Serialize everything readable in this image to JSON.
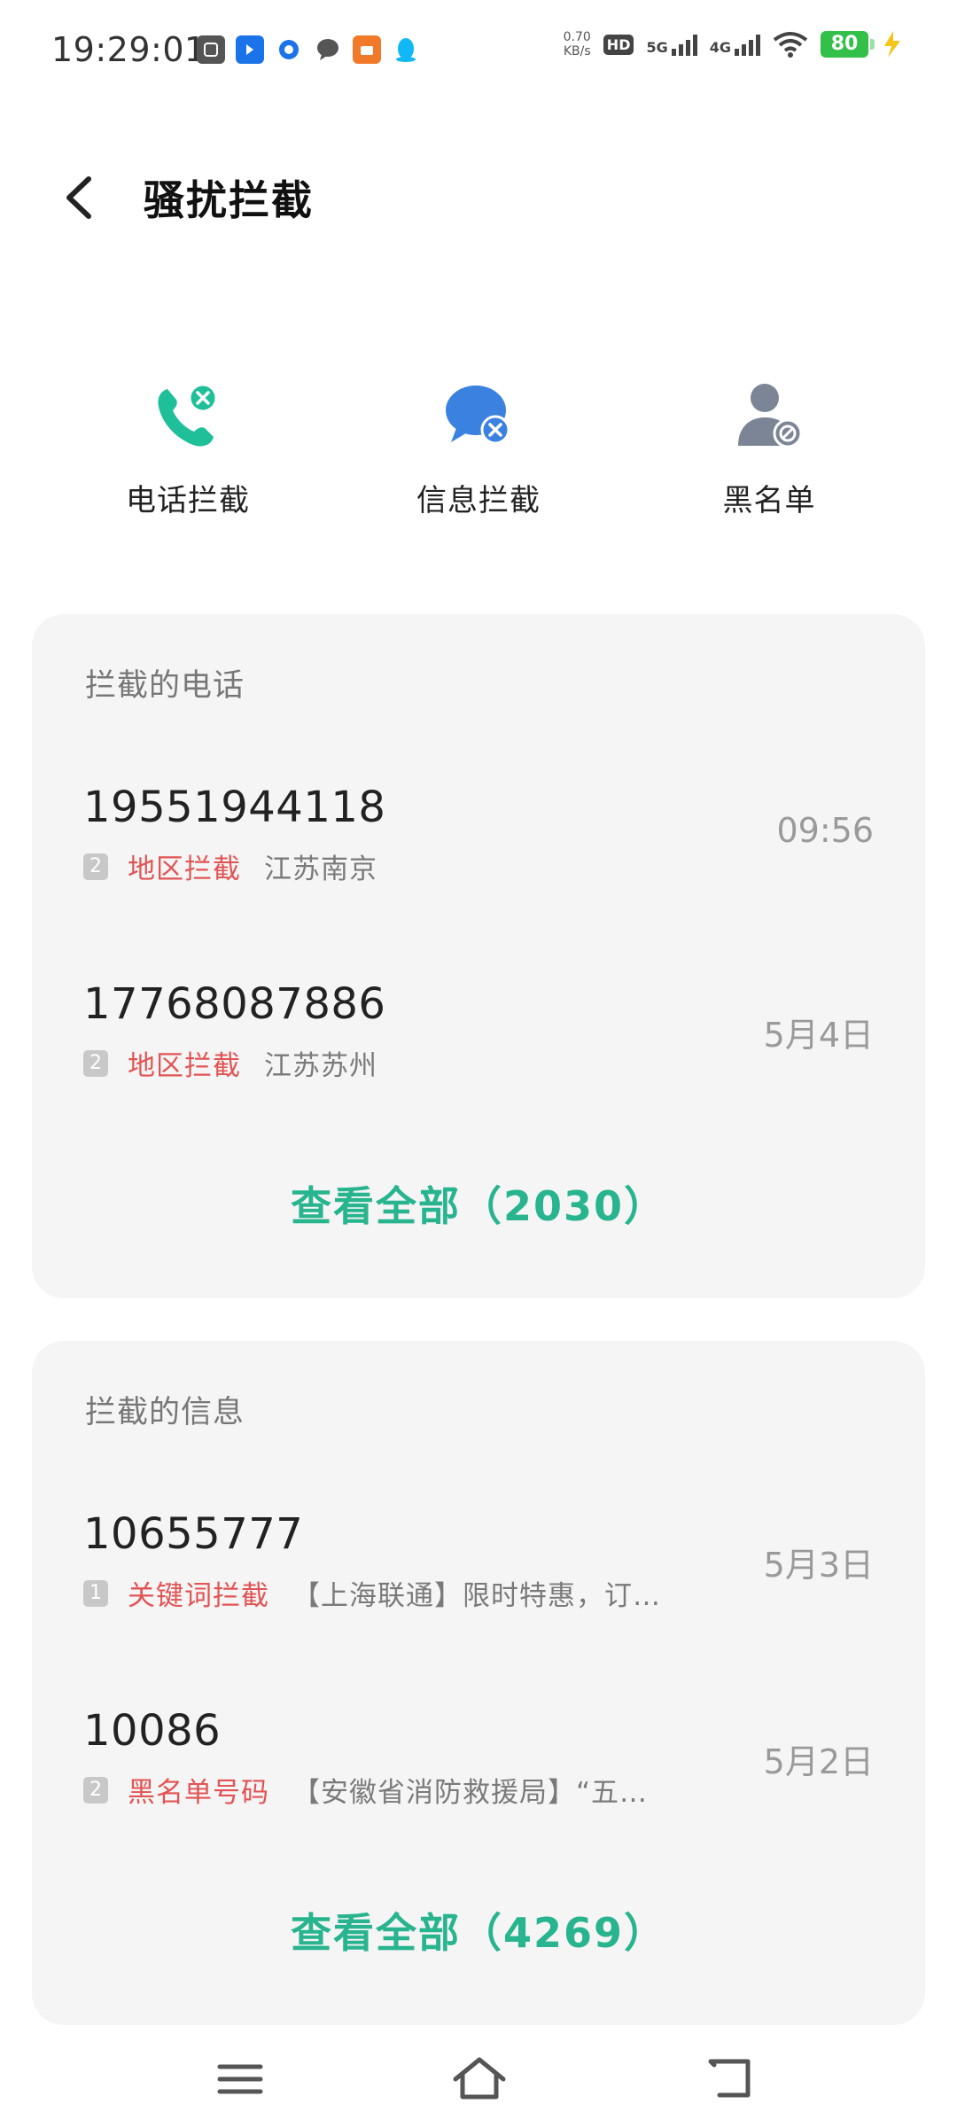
{
  "status_bar": {
    "time": "19:29:01",
    "net_speed_value": "0.70",
    "net_speed_unit": "KB/s",
    "hd_label": "HD",
    "sim_5g": "5G",
    "sim_4g": "4G",
    "battery": "80",
    "battery_color": "#32c048"
  },
  "header": {
    "title": "骚扰拦截",
    "back_icon": "chevron-left-icon"
  },
  "actions": [
    {
      "label": "电话拦截",
      "icon": "phone-block-icon",
      "color": "#1fbf9a"
    },
    {
      "label": "信息拦截",
      "icon": "message-block-icon",
      "color": "#3b82e0"
    },
    {
      "label": "黑名单",
      "icon": "blacklist-user-icon",
      "color": "#7c8596"
    }
  ],
  "blocked_calls": {
    "title": "拦截的电话",
    "items": [
      {
        "number": "19551944118",
        "sim": "2",
        "tag": "地区拦截",
        "location": "江苏南京",
        "time": "09:56"
      },
      {
        "number": "17768087886",
        "sim": "2",
        "tag": "地区拦截",
        "location": "江苏苏州",
        "time": "5月4日"
      }
    ],
    "view_all": "查看全部（2030）"
  },
  "blocked_messages": {
    "title": "拦截的信息",
    "items": [
      {
        "number": "10655777",
        "sim": "1",
        "tag": "关键词拦截",
        "preview": "【上海联通】限时特惠，订…",
        "time": "5月3日"
      },
      {
        "number": "10086",
        "sim": "2",
        "tag": "黑名单号码",
        "preview": "【安徽省消防救援局】“五…",
        "time": "5月2日"
      }
    ],
    "view_all": "查看全部（4269）"
  },
  "accent_color": "#27b48e",
  "tag_color": "#e25454",
  "nav_bar": {
    "menu_icon": "menu-icon",
    "home_icon": "home-icon",
    "back_icon": "back-icon"
  }
}
